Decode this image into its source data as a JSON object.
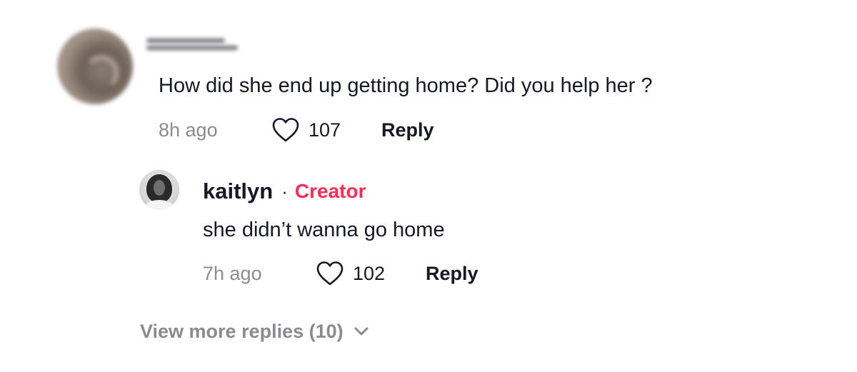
{
  "comment": {
    "text": "How did she end up getting home? Did you help her ?",
    "time": "8h ago",
    "likes": "107",
    "reply_label": "Reply"
  },
  "reply": {
    "username": "kaitlyn",
    "separator": "·",
    "badge": "Creator",
    "text": "she didn’t wanna go home",
    "time": "7h ago",
    "likes": "102",
    "reply_label": "Reply"
  },
  "view_more_label": "View more replies (10)",
  "icons": {
    "like": "heart-outline-icon",
    "expand": "chevron-down-icon"
  },
  "colors": {
    "text": "#161823",
    "secondary": "#8a8b91",
    "creator_badge": "#fe2c55"
  }
}
